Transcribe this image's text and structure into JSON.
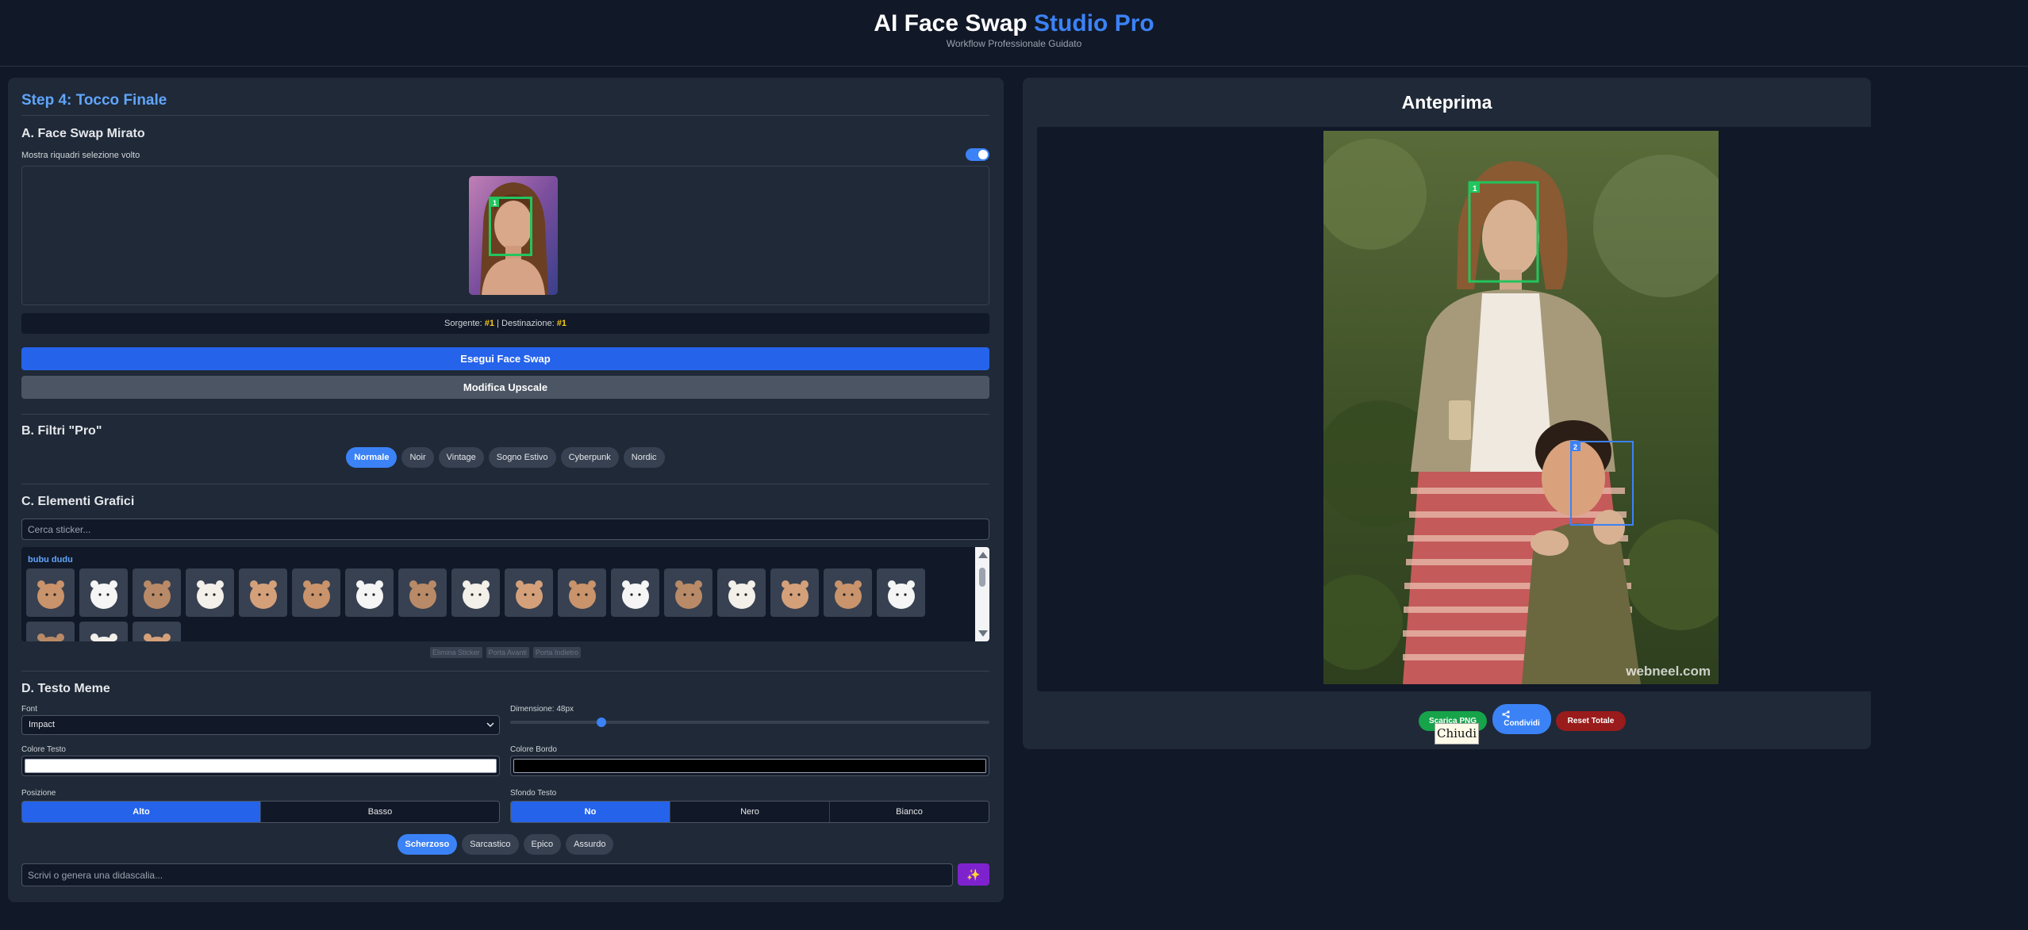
{
  "header": {
    "title_main": "AI Face Swap",
    "title_accent": "Studio Pro",
    "subtitle": "Workflow Professionale Guidato"
  },
  "colors": {
    "accent": "#3b82f6",
    "primary_button": "#2563eb",
    "secondary_button": "#4b5563",
    "download_button": "#16a34a",
    "reset_button": "#991b1b",
    "magic_button": "#7e22ce",
    "highlight": "#facc15",
    "face_box_1": "#22c55e",
    "face_box_2": "#3b82f6"
  },
  "left": {
    "step_title": "Step 4: Tocco Finale",
    "face_swap": {
      "title": "A. Face Swap Mirato",
      "toggle_label": "Mostra riquadri selezione volto",
      "toggle_on": true,
      "thumb_box_number": "1",
      "source_label": "Sorgente:",
      "source_value": "#1",
      "separator": "|",
      "dest_label": "Destinazione:",
      "dest_value": "#1",
      "execute_button": "Esegui Face Swap",
      "upscale_button": "Modifica Upscale"
    },
    "filters": {
      "title": "B. Filtri \"Pro\"",
      "items": [
        "Normale",
        "Noir",
        "Vintage",
        "Sogno Estivo",
        "Cyberpunk",
        "Nordic"
      ],
      "active": "Normale"
    },
    "graphics": {
      "title": "C. Elementi Grafici",
      "search_placeholder": "Cerca sticker...",
      "pack_name": "bubu dudu",
      "sticker_count": 20,
      "actions": [
        "Elimina Sticker",
        "Porta Avanti",
        "Porta Indietro"
      ]
    },
    "meme": {
      "title": "D. Testo Meme",
      "font_label": "Font",
      "font_value": "Impact",
      "size_label": "Dimensione: 48px",
      "size_fraction": 0.19,
      "text_color_label": "Colore Testo",
      "text_color": "#ffffff",
      "border_color_label": "Colore Bordo",
      "border_color": "#000000",
      "position_label": "Posizione",
      "position_options": [
        "Alto",
        "Basso"
      ],
      "position_active": "Alto",
      "bg_label": "Sfondo Testo",
      "bg_options": [
        "No",
        "Nero",
        "Bianco"
      ],
      "bg_active": "No",
      "tones": [
        "Scherzoso",
        "Sarcastico",
        "Epico",
        "Assurdo"
      ],
      "tone_active": "Scherzoso",
      "caption_placeholder": "Scrivi o genera una didascalia...",
      "magic_icon": "✨"
    }
  },
  "right": {
    "title": "Anteprima",
    "watermark": "webneel.com",
    "face_box_1_number": "1",
    "face_box_2_number": "2",
    "download_button": "Scarica PNG",
    "share_button": "Condividi",
    "reset_button": "Reset Totale",
    "tooltip": "Chiudi"
  }
}
